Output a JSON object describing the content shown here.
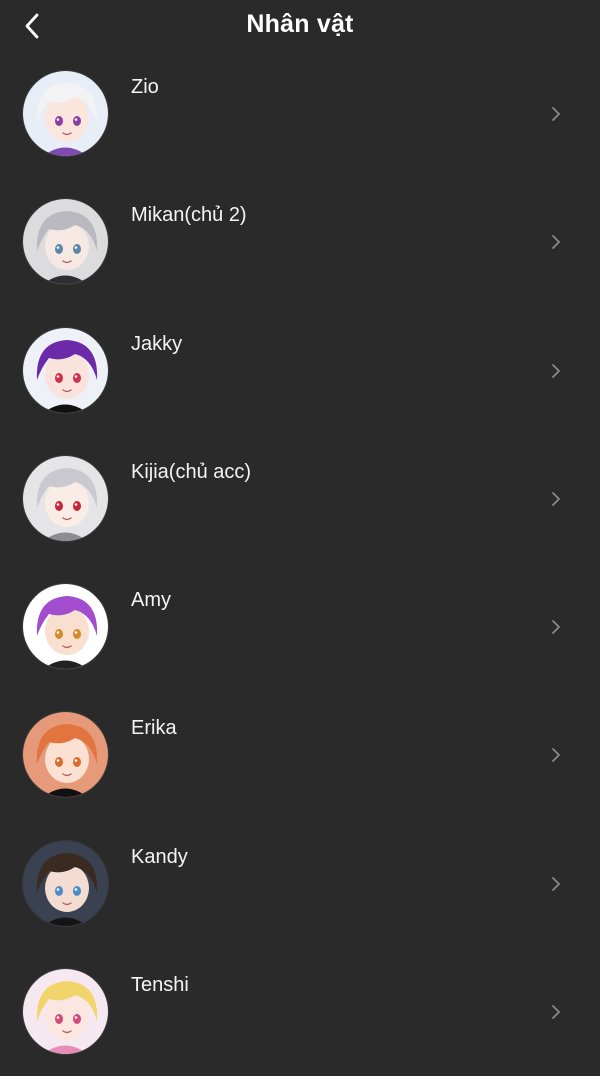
{
  "header": {
    "title": "Nhân vật",
    "back_icon": "chevron-left-icon"
  },
  "characters": [
    {
      "name": "Zio",
      "avatar": {
        "bg": "#e8eef7",
        "hair": "#f3f3f6",
        "accent": "#7e4bb0",
        "skin": "#fbe6de",
        "eye": "#8a3fa6"
      }
    },
    {
      "name": "Mikan(chủ 2)",
      "avatar": {
        "bg": "#dcdcdf",
        "hair": "#b9b9bf",
        "accent": "#2d2d33",
        "skin": "#f6e9e4",
        "eye": "#5b86a6"
      }
    },
    {
      "name": "Jakky",
      "avatar": {
        "bg": "#eef1f8",
        "hair": "#6b2aa8",
        "accent": "#111111",
        "skin": "#f9e3dc",
        "eye": "#d0304a"
      }
    },
    {
      "name": "Kijia(chủ acc)",
      "avatar": {
        "bg": "#e5e5e8",
        "hair": "#c9c9cf",
        "accent": "#8c8c92",
        "skin": "#faece6",
        "eye": "#c6263a"
      }
    },
    {
      "name": "Amy",
      "avatar": {
        "bg": "#ffffff",
        "hair": "#a24dd0",
        "accent": "#222222",
        "skin": "#f8dfcf",
        "eye": "#d58a2a"
      }
    },
    {
      "name": "Erika",
      "avatar": {
        "bg": "#e69a7a",
        "hair": "#e2743f",
        "accent": "#111111",
        "skin": "#fbe1d2",
        "eye": "#d96b2c"
      }
    },
    {
      "name": "Kandy",
      "avatar": {
        "bg": "#3a4150",
        "hair": "#3a2a22",
        "accent": "#151515",
        "skin": "#f3ddd3",
        "eye": "#4f8cc7"
      }
    },
    {
      "name": "Tenshi",
      "avatar": {
        "bg": "#f6e8f0",
        "hair": "#f1d46a",
        "accent": "#e58fb8",
        "skin": "#fbe7e0",
        "eye": "#d14a7a"
      }
    }
  ],
  "row_chevron_icon": "chevron-right-icon",
  "colors": {
    "background": "#2a2a2a",
    "text": "#f4f4f4",
    "chevron": "#8a8a8a"
  }
}
